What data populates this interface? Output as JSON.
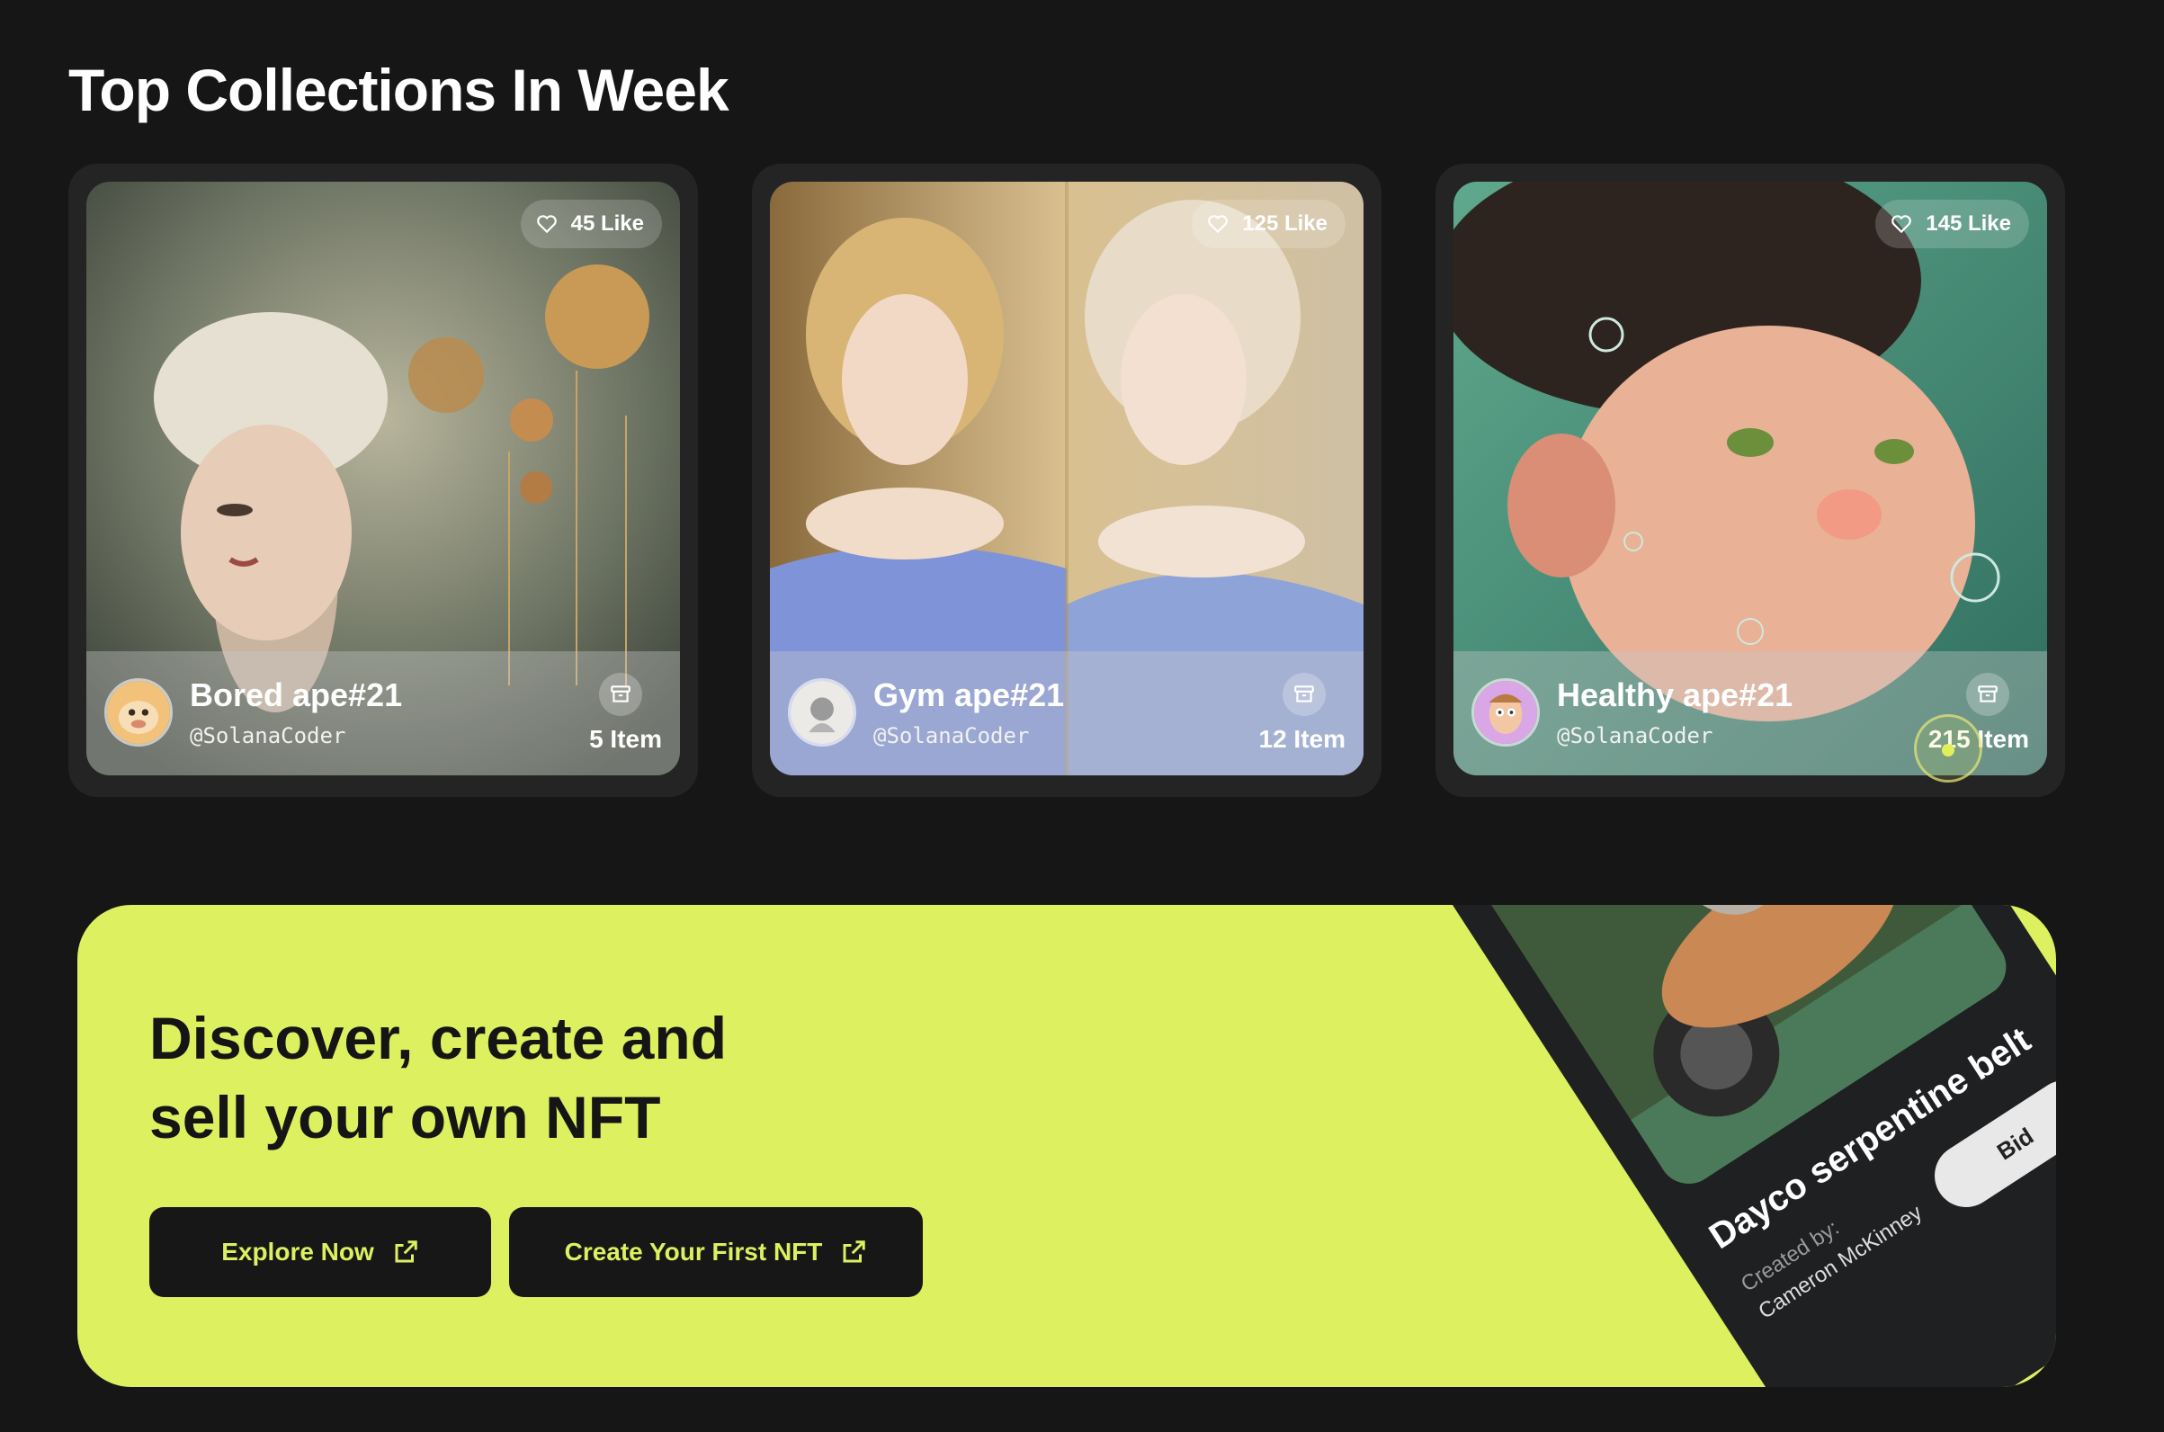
{
  "section": {
    "title": "Top Collections In Week"
  },
  "cards": [
    {
      "likes": "45 Like",
      "name": "Bored ape#21",
      "handle": "@SolanaCoder",
      "items": "5 Item"
    },
    {
      "likes": "125 Like",
      "name": "Gym ape#21",
      "handle": "@SolanaCoder",
      "items": "12 Item"
    },
    {
      "likes": "145 Like",
      "name": "Healthy ape#21",
      "handle": "@SolanaCoder",
      "items": "215 Item"
    }
  ],
  "banner": {
    "title_line1": "Discover, create and",
    "title_line2": "sell your own NFT",
    "explore_label": "Explore Now",
    "create_label": "Create Your First NFT"
  },
  "phone": {
    "title": "Dayco serpentine belt",
    "created_by": "Created by:",
    "creator": "Cameron McKinney",
    "bid_label": "Bid"
  },
  "colors": {
    "background": "#161616",
    "accent": "#dcf060",
    "card_frame": "#242424"
  }
}
